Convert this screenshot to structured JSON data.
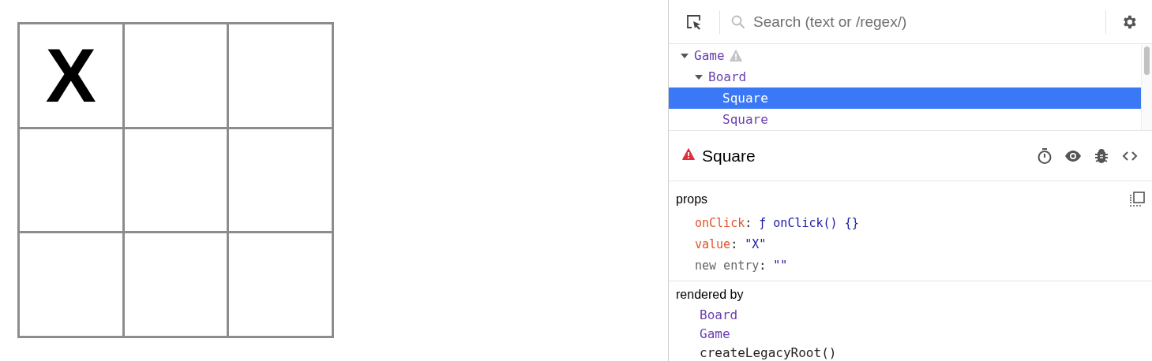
{
  "board": {
    "squares": [
      {
        "kind": "mark",
        "value": "X"
      },
      {
        "kind": "empty"
      },
      {
        "kind": "empty"
      },
      {
        "kind": "empty"
      },
      {
        "kind": "empty"
      },
      {
        "kind": "empty"
      },
      {
        "kind": "empty"
      },
      {
        "kind": "empty"
      },
      {
        "kind": "empty"
      }
    ]
  },
  "devtools": {
    "search": {
      "placeholder": "Search (text or /regex/)"
    },
    "tree": [
      {
        "name": "Game",
        "warning": true,
        "expanded": true,
        "selected": false,
        "children": [
          {
            "name": "Board",
            "warning": false,
            "expanded": true,
            "selected": false,
            "children": [
              {
                "name": "Square",
                "warning": false,
                "selected": true
              },
              {
                "name": "Square",
                "warning": false,
                "selected": false
              }
            ]
          }
        ]
      }
    ],
    "inspected": {
      "name": "Square",
      "warning": true
    },
    "props": {
      "title": "props",
      "entries": [
        {
          "kind": "prop",
          "key": "onClick",
          "colon": ":",
          "value": "ƒ onClick() {}"
        },
        {
          "kind": "prop",
          "key": "value",
          "colon": ":",
          "value": "\"X\""
        },
        {
          "kind": "new",
          "key": "new entry",
          "colon": ":",
          "value": "\"\""
        }
      ]
    },
    "rendered_by": {
      "title": "rendered by",
      "items": [
        {
          "kind": "component",
          "name": "Board"
        },
        {
          "kind": "component",
          "name": "Game"
        },
        {
          "kind": "root",
          "name": "createLegacyRoot()"
        }
      ]
    }
  }
}
